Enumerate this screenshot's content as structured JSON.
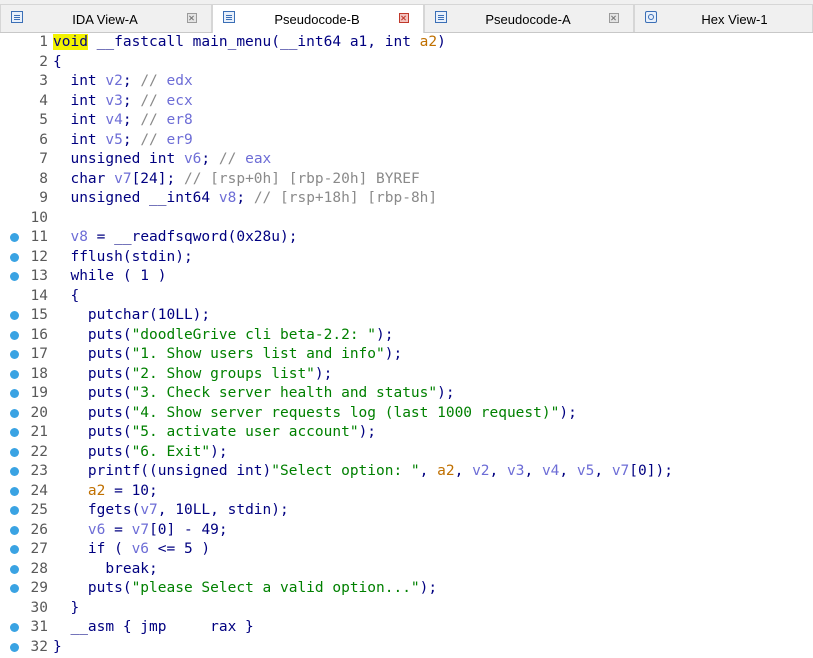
{
  "tabs": [
    {
      "label": "IDA View-A",
      "active": false,
      "icon": "view-icon"
    },
    {
      "label": "Pseudocode-B",
      "active": true,
      "icon": "view-icon"
    },
    {
      "label": "Pseudocode-A",
      "active": false,
      "icon": "view-icon"
    },
    {
      "label": "Hex View-1",
      "active": false,
      "icon": "hex-icon"
    }
  ],
  "colors": {
    "keyword": "#000080",
    "comment": "#8a8a8a",
    "register": "#6d6dd6",
    "string": "#008000",
    "argument": "#c07000",
    "breakpoint": "#3aa3e3",
    "cursor_highlight": "#f2f200"
  },
  "lines": [
    {
      "n": "1",
      "bp": false,
      "text": "void __fastcall main_menu(__int64 a1, int a2)"
    },
    {
      "n": "2",
      "bp": false,
      "text": "{"
    },
    {
      "n": "3",
      "bp": false,
      "text": "  int v2; // edx"
    },
    {
      "n": "4",
      "bp": false,
      "text": "  int v3; // ecx"
    },
    {
      "n": "5",
      "bp": false,
      "text": "  int v4; // er8"
    },
    {
      "n": "6",
      "bp": false,
      "text": "  int v5; // er9"
    },
    {
      "n": "7",
      "bp": false,
      "text": "  unsigned int v6; // eax"
    },
    {
      "n": "8",
      "bp": false,
      "text": "  char v7[24]; // [rsp+0h] [rbp-20h] BYREF"
    },
    {
      "n": "9",
      "bp": false,
      "text": "  unsigned __int64 v8; // [rsp+18h] [rbp-8h]"
    },
    {
      "n": "10",
      "bp": false,
      "text": ""
    },
    {
      "n": "11",
      "bp": true,
      "text": "  v8 = __readfsqword(0x28u);"
    },
    {
      "n": "12",
      "bp": true,
      "text": "  fflush(stdin);"
    },
    {
      "n": "13",
      "bp": true,
      "text": "  while ( 1 )"
    },
    {
      "n": "14",
      "bp": false,
      "text": "  {"
    },
    {
      "n": "15",
      "bp": true,
      "text": "    putchar(10LL);"
    },
    {
      "n": "16",
      "bp": true,
      "text": "    puts(\"doodleGrive cli beta-2.2: \");"
    },
    {
      "n": "17",
      "bp": true,
      "text": "    puts(\"1. Show users list and info\");"
    },
    {
      "n": "18",
      "bp": true,
      "text": "    puts(\"2. Show groups list\");"
    },
    {
      "n": "19",
      "bp": true,
      "text": "    puts(\"3. Check server health and status\");"
    },
    {
      "n": "20",
      "bp": true,
      "text": "    puts(\"4. Show server requests log (last 1000 request)\");"
    },
    {
      "n": "21",
      "bp": true,
      "text": "    puts(\"5. activate user account\");"
    },
    {
      "n": "22",
      "bp": true,
      "text": "    puts(\"6. Exit\");"
    },
    {
      "n": "23",
      "bp": true,
      "text": "    printf((unsigned int)\"Select option: \", a2, v2, v3, v4, v5, v7[0]);"
    },
    {
      "n": "24",
      "bp": true,
      "text": "    a2 = 10;"
    },
    {
      "n": "25",
      "bp": true,
      "text": "    fgets(v7, 10LL, stdin);"
    },
    {
      "n": "26",
      "bp": true,
      "text": "    v6 = v7[0] - 49;"
    },
    {
      "n": "27",
      "bp": true,
      "text": "    if ( v6 <= 5 )"
    },
    {
      "n": "28",
      "bp": true,
      "text": "      break;"
    },
    {
      "n": "29",
      "bp": true,
      "text": "    puts(\"please Select a valid option...\");"
    },
    {
      "n": "30",
      "bp": false,
      "text": "  }"
    },
    {
      "n": "31",
      "bp": true,
      "text": "  __asm { jmp     rax }"
    },
    {
      "n": "32",
      "bp": true,
      "text": "}"
    }
  ]
}
